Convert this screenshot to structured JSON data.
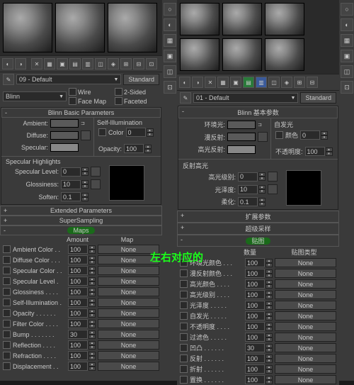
{
  "left": {
    "mat_dropdown": "09 - Default",
    "shader_btn": "Standard",
    "shader_dd": "Blinn",
    "opts": {
      "wire": "Wire",
      "twoSided": "2-Sided",
      "faceMap": "Face Map",
      "faceted": "Faceted"
    },
    "sec_basic": "Blinn Basic Parameters",
    "sec_selfillum": "Self-Illumination",
    "ambient": "Ambient:",
    "diffuse": "Diffuse:",
    "specular": "Specular:",
    "color": "Color",
    "opacity": "Opacity:",
    "opacity_val": "100",
    "sec_spec": "Specular Highlights",
    "spec_level": "Specular Level:",
    "spec_level_val": "0",
    "gloss": "Glossiness:",
    "gloss_val": "10",
    "soften": "Soften:",
    "soften_val": "0.1",
    "sec_ext": "Extended Parameters",
    "sec_ss": "SuperSampling",
    "sec_maps": "Maps",
    "col_amount": "Amount",
    "col_map": "Map",
    "maps": [
      {
        "n": "Ambient Color . .",
        "v": "100"
      },
      {
        "n": "Diffuse Color . . .",
        "v": "100"
      },
      {
        "n": "Specular Color . .",
        "v": "100"
      },
      {
        "n": "Specular Level .",
        "v": "100"
      },
      {
        "n": "Glossiness . . . .",
        "v": "100"
      },
      {
        "n": "Self-Illumination .",
        "v": "100"
      },
      {
        "n": "Opacity . . . . . .",
        "v": "100"
      },
      {
        "n": "Filter Color . . . .",
        "v": "100"
      },
      {
        "n": "Bump . . . . . . .",
        "v": "30"
      },
      {
        "n": "Reflection . . . .",
        "v": "100"
      },
      {
        "n": "Refraction . . . .",
        "v": "100"
      },
      {
        "n": "Displacement . .",
        "v": "100"
      }
    ],
    "none": "None",
    "color_val": "0"
  },
  "right": {
    "mat_dropdown": "01 - Default",
    "shader_btn": "Standard",
    "shader_dd": "Blinn",
    "sec_basic": "Blinn 基本参数",
    "sec_selfillum": "自发光",
    "ambient": "环境光:",
    "diffuse": "漫反射:",
    "specular": "高光反射:",
    "color": "颜色",
    "opacity": "不透明度:",
    "opacity_val": "100",
    "sec_spec": "反射高光",
    "spec_level": "高光级别:",
    "spec_level_val": "0",
    "gloss": "光泽度:",
    "gloss_val": "10",
    "soften": "柔化:",
    "soften_val": "0.1",
    "sec_ext": "扩展参数",
    "sec_ss": "超级采样",
    "sec_maps": "贴图",
    "col_amount": "数量",
    "col_map": "贴图类型",
    "maps": [
      {
        "n": "环境光颜色 . . .",
        "v": "100"
      },
      {
        "n": "漫反射颜色 . . .",
        "v": "100"
      },
      {
        "n": "高光颜色 . . . .",
        "v": "100"
      },
      {
        "n": "高光级别 . . . .",
        "v": "100"
      },
      {
        "n": "光泽度 . . . . .",
        "v": "100"
      },
      {
        "n": "自发光 . . . . .",
        "v": "100"
      },
      {
        "n": "不透明度 . . . .",
        "v": "100"
      },
      {
        "n": "过滤色 . . . . .",
        "v": "100"
      },
      {
        "n": "凹凸 . . . . . .",
        "v": "30"
      },
      {
        "n": "反射 . . . . . .",
        "v": "100"
      },
      {
        "n": "折射 . . . . . .",
        "v": "100"
      },
      {
        "n": "置换 . . . . . .",
        "v": "100"
      }
    ],
    "none": "None",
    "color_val": "0"
  },
  "center_label": "左右对应的"
}
